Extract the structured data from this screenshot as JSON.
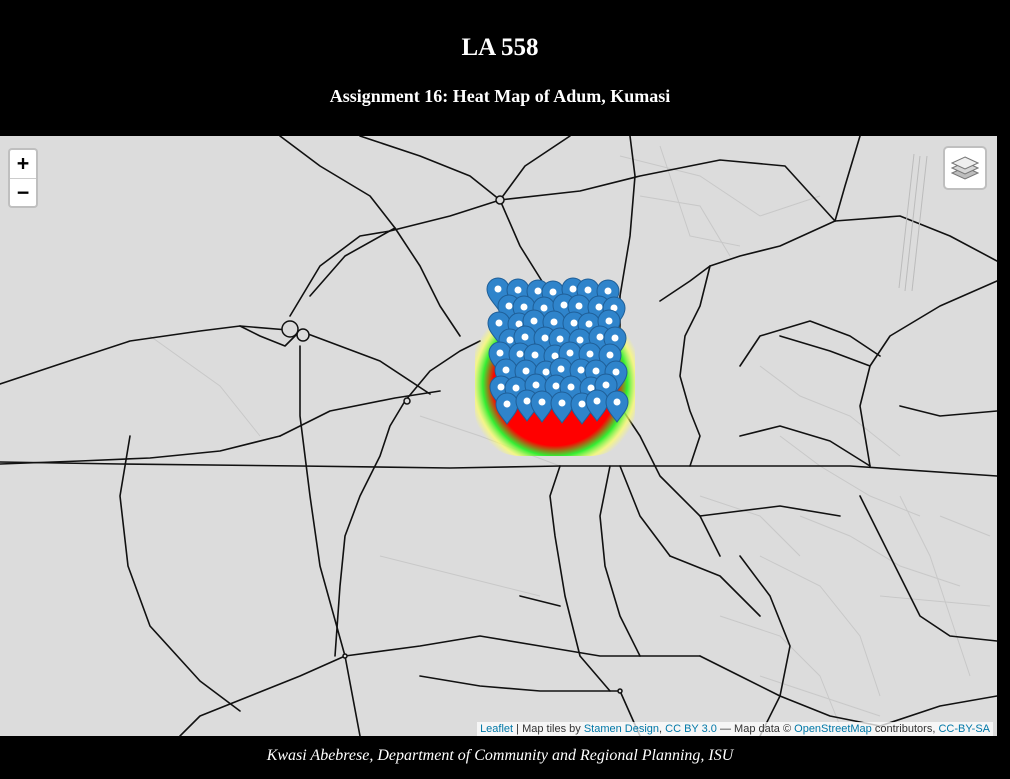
{
  "header": {
    "title": "LA 558",
    "subtitle": "Assignment 16: Heat Map of Adum, Kumasi"
  },
  "map": {
    "zoom_in_label": "+",
    "zoom_out_label": "−",
    "layers_icon": "layers-icon",
    "marker_color": "#2f84cb",
    "attribution": {
      "leaflet": "Leaflet",
      "sep1": " | Map tiles by ",
      "stamen": "Stamen Design",
      "sep2": ", ",
      "ccby": "CC BY 3.0",
      "sep3": " — Map data © ",
      "osm": "OpenStreetMap",
      "sep4": " contributors, ",
      "ccbysa": "CC-BY-SA"
    }
  },
  "footer": {
    "text": "Kwasi Abebrese, Department of Community and Regional Planning, ISU"
  }
}
